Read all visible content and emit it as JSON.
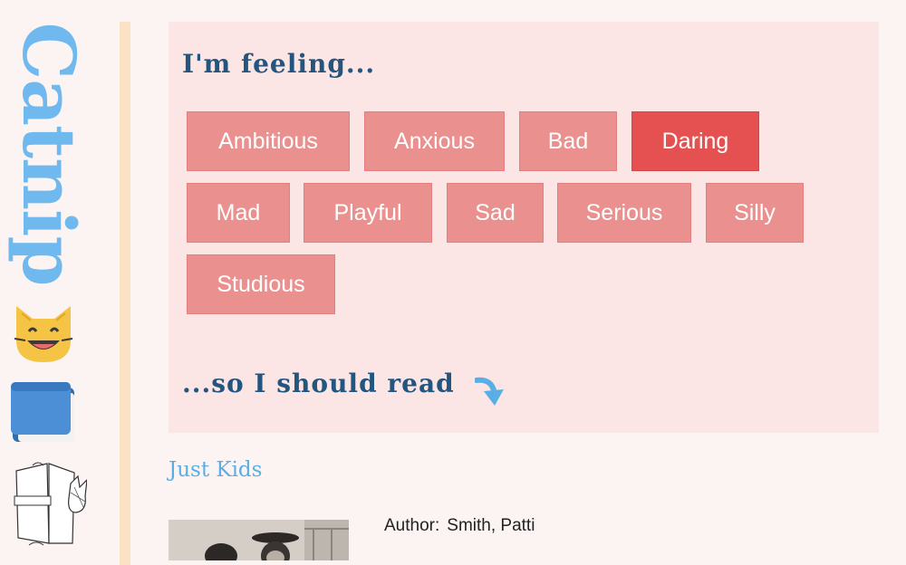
{
  "site": {
    "logo_text": "Catnip"
  },
  "icons": {
    "cat": "cat-face-icon",
    "book": "blue-book-icon",
    "sketch": "cat-reading-book-sketch-icon",
    "arrow": "curved-down-arrow-icon"
  },
  "mood": {
    "heading": "I'm feeling...",
    "moods": [
      {
        "label": "Ambitious",
        "active": false
      },
      {
        "label": "Anxious",
        "active": false
      },
      {
        "label": "Bad",
        "active": false
      },
      {
        "label": "Daring",
        "active": true
      },
      {
        "label": "Mad",
        "active": false
      },
      {
        "label": "Playful",
        "active": false
      },
      {
        "label": "Sad",
        "active": false
      },
      {
        "label": "Serious",
        "active": false
      },
      {
        "label": "Silly",
        "active": false
      },
      {
        "label": "Studious",
        "active": false
      }
    ],
    "read_heading": "...so I should read"
  },
  "book": {
    "title": "Just Kids",
    "author_label": "Author:",
    "author_value": "Smith, Patti"
  },
  "colors": {
    "button": "#ea9190",
    "button_active": "#e45150",
    "heading": "#23557f",
    "accent": "#70b9ee"
  }
}
